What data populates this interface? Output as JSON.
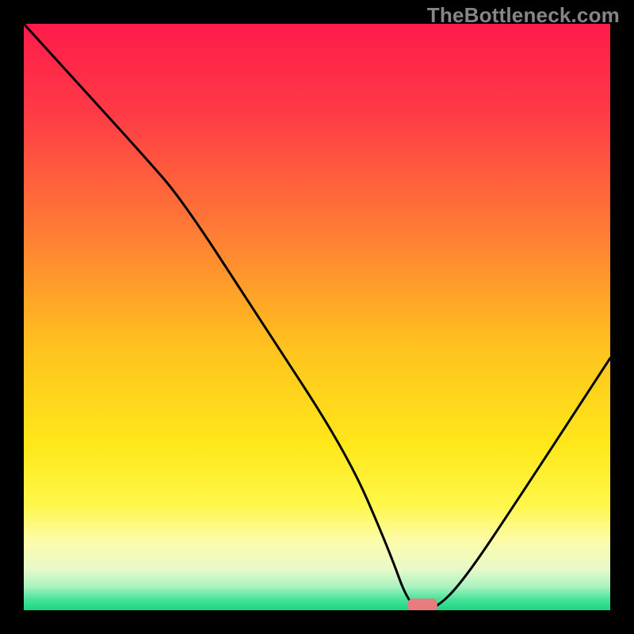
{
  "watermark": "TheBottleneck.com",
  "chart_data": {
    "type": "line",
    "title": "",
    "xlabel": "",
    "ylabel": "",
    "xlim": [
      0,
      100
    ],
    "ylim": [
      0,
      100
    ],
    "grid": false,
    "legend": false,
    "series": [
      {
        "name": "bottleneck-curve",
        "x": [
          0,
          10,
          20,
          27,
          40,
          55,
          62,
          66,
          70,
          75,
          85,
          100
        ],
        "y": [
          100,
          89,
          78,
          70,
          50,
          27,
          11,
          0,
          0,
          5,
          20,
          43
        ]
      }
    ],
    "marker": {
      "name": "selected-point",
      "x": 68,
      "y": 0,
      "color": "#e87b7e",
      "width": 5,
      "height": 2
    },
    "background_gradient_stops": [
      {
        "offset": 0,
        "color": "#ff1b4b"
      },
      {
        "offset": 15,
        "color": "#ff3a46"
      },
      {
        "offset": 35,
        "color": "#ff7a35"
      },
      {
        "offset": 55,
        "color": "#ffc21e"
      },
      {
        "offset": 72,
        "color": "#ffe81a"
      },
      {
        "offset": 82,
        "color": "#fff74a"
      },
      {
        "offset": 88,
        "color": "#fdfca8"
      },
      {
        "offset": 93,
        "color": "#e8faca"
      },
      {
        "offset": 96,
        "color": "#a8f2c0"
      },
      {
        "offset": 98,
        "color": "#4fe39c"
      },
      {
        "offset": 100,
        "color": "#17d884"
      }
    ]
  }
}
